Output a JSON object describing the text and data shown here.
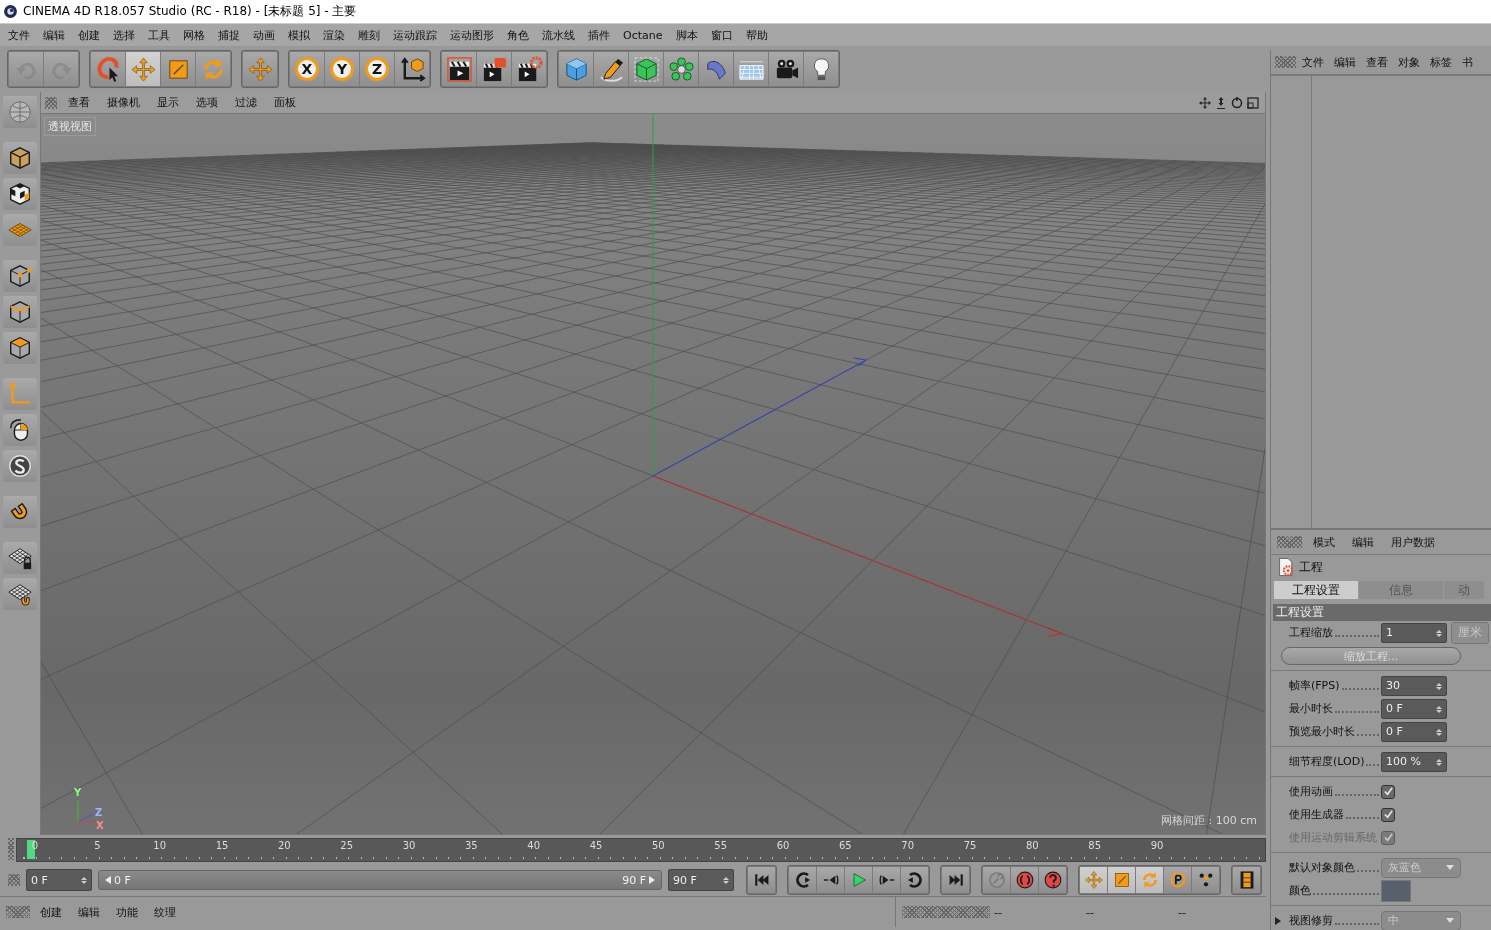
{
  "window": {
    "title": "CINEMA 4D R18.057 Studio (RC - R18) - [未标题 5] - 主要"
  },
  "menu": [
    "文件",
    "编辑",
    "创建",
    "选择",
    "工具",
    "网格",
    "捕捉",
    "动画",
    "模拟",
    "渲染",
    "雕刻",
    "运动跟踪",
    "运动图形",
    "角色",
    "流水线",
    "插件",
    "Octane",
    "脚本",
    "窗口",
    "帮助"
  ],
  "toolbar": {
    "groups": [
      {
        "tools": [
          {
            "kind": "undo",
            "disabled": true
          },
          {
            "kind": "redo",
            "disabled": true
          }
        ]
      },
      {
        "tools": [
          {
            "kind": "live-select",
            "selected": false
          },
          {
            "kind": "move",
            "selected": true
          },
          {
            "kind": "scale",
            "selected": false
          },
          {
            "kind": "rotate",
            "selected": false
          }
        ]
      },
      {
        "tools": [
          {
            "kind": "move-recent"
          }
        ]
      },
      {
        "tools": [
          {
            "kind": "axis",
            "label": "X"
          },
          {
            "kind": "axis",
            "label": "Y"
          },
          {
            "kind": "axis",
            "label": "Z"
          },
          {
            "kind": "coords"
          }
        ]
      },
      {
        "tools": [
          {
            "kind": "render-view"
          },
          {
            "kind": "render-picture"
          },
          {
            "kind": "render-settings"
          }
        ]
      },
      {
        "tools": [
          {
            "kind": "cube"
          },
          {
            "kind": "pen"
          },
          {
            "kind": "subdivision"
          },
          {
            "kind": "cloner"
          },
          {
            "kind": "bend"
          },
          {
            "kind": "floor"
          },
          {
            "kind": "camera"
          },
          {
            "kind": "light"
          }
        ]
      }
    ]
  },
  "viewport": {
    "menu": [
      "查看",
      "摄像机",
      "显示",
      "选项",
      "过滤",
      "面板"
    ],
    "label": "透视视图",
    "grid_spacing": "网格间距 : 100 cm",
    "gizmo_labels": [
      "Y",
      "Z",
      "X"
    ]
  },
  "timeline": {
    "ticks": [
      "0",
      "5",
      "10",
      "15",
      "20",
      "25",
      "30",
      "35",
      "40",
      "45",
      "50",
      "55",
      "60",
      "65",
      "70",
      "75",
      "80",
      "85",
      "90"
    ],
    "playhead": {
      "level": 0
    },
    "start_field": "0 F",
    "slider": {
      "level": 1
    },
    "slider_start": "0 F",
    "slider_end": "90 F",
    "end_field": "90 F"
  },
  "material_manager": {
    "menu": [
      "创建",
      "编辑",
      "功能",
      "纹理"
    ]
  },
  "coordinates_manager": {
    "columns": [
      "--",
      "--",
      "--"
    ]
  },
  "object_manager": {
    "menu": [
      "文件",
      "编辑",
      "查看",
      "对象",
      "标签",
      "书"
    ]
  },
  "attribute_manager": {
    "menu": [
      "模式",
      "编辑",
      "用户数据"
    ],
    "title": "工程",
    "tabs": [
      {
        "label": "工程设置",
        "selected": true
      },
      {
        "label": "信息",
        "selected": false
      },
      {
        "label": "动",
        "selected": false
      }
    ],
    "section": "工程设置",
    "rows": [
      {
        "kind": "number",
        "label": "工程缩放",
        "value": "1",
        "unit": "厘米"
      },
      {
        "kind": "button",
        "label": "缩放工程..."
      },
      {
        "kind": "divider"
      },
      {
        "kind": "number",
        "label": "帧率(FPS)",
        "value": "30"
      },
      {
        "kind": "number",
        "label": "最小时长",
        "value": "0 F"
      },
      {
        "kind": "number",
        "label": "预览最小时长",
        "value": "0 F"
      },
      {
        "kind": "divider"
      },
      {
        "kind": "number",
        "label": "细节程度(LOD)",
        "value": "100 %"
      },
      {
        "kind": "divider"
      },
      {
        "kind": "check",
        "label": "使用动画",
        "checked": true,
        "disabled": false
      },
      {
        "kind": "check",
        "label": "使用生成器",
        "checked": true,
        "disabled": false
      },
      {
        "kind": "check",
        "label": "使用运动剪辑系统",
        "checked": true,
        "disabled": true
      },
      {
        "kind": "divider"
      },
      {
        "kind": "dropdown",
        "label": "默认对象颜色",
        "value": "灰蓝色"
      },
      {
        "kind": "color",
        "label": "颜色",
        "color": "#58606c"
      },
      {
        "kind": "divider"
      },
      {
        "kind": "group",
        "label": "视图修剪",
        "expanded": false,
        "value": "中"
      }
    ]
  }
}
